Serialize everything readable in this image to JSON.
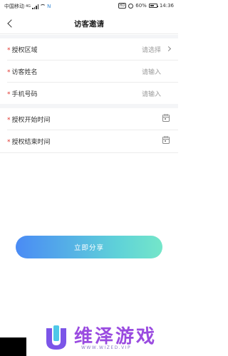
{
  "status_bar": {
    "carrier": "中国移动",
    "network": "4G",
    "nfc": "N",
    "hd": "HD",
    "battery": "60%",
    "battery_level": 0.6,
    "time": "14:36"
  },
  "header": {
    "title": "访客邀请",
    "back_icon": "back-arrow"
  },
  "form": {
    "required_mark": "*",
    "fields": [
      {
        "label": "授权区域",
        "value": "请选择",
        "control": "chevron-right"
      },
      {
        "label": "访客姓名",
        "value": "请输入"
      },
      {
        "label": "手机号码",
        "value": "请输入"
      },
      {
        "label": "授权开始时间",
        "control": "calendar-icon"
      },
      {
        "label": "授权结束时间",
        "control": "calendar-icon"
      }
    ]
  },
  "actions": {
    "share_label": "立即分享"
  },
  "watermark": {
    "text": "维泽游戏",
    "sub": "WWW.WIZED.VIP"
  },
  "colors": {
    "required": "#e0322b",
    "button_gradient_start": "#4a8bf5",
    "button_gradient_end": "#74e6c9",
    "watermark": "#9a4be0"
  }
}
